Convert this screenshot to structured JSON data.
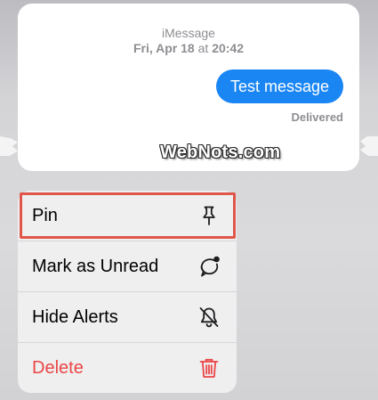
{
  "message_preview": {
    "service": "iMessage",
    "date": "Fri, Apr 18",
    "at_word": "at",
    "time": "20:42",
    "message_text": "Test message",
    "status": "Delivered",
    "bubble_color": "#1a86f4"
  },
  "watermark": {
    "text": "WebNots.com"
  },
  "context_menu": {
    "highlight_color": "#e0564b",
    "destructive_color": "#eb4545",
    "items": [
      {
        "label": "Pin",
        "icon": "pin-icon"
      },
      {
        "label": "Mark as Unread",
        "icon": "unread-bubble-icon"
      },
      {
        "label": "Hide Alerts",
        "icon": "bell-slash-icon"
      },
      {
        "label": "Delete",
        "icon": "trash-icon"
      }
    ]
  }
}
